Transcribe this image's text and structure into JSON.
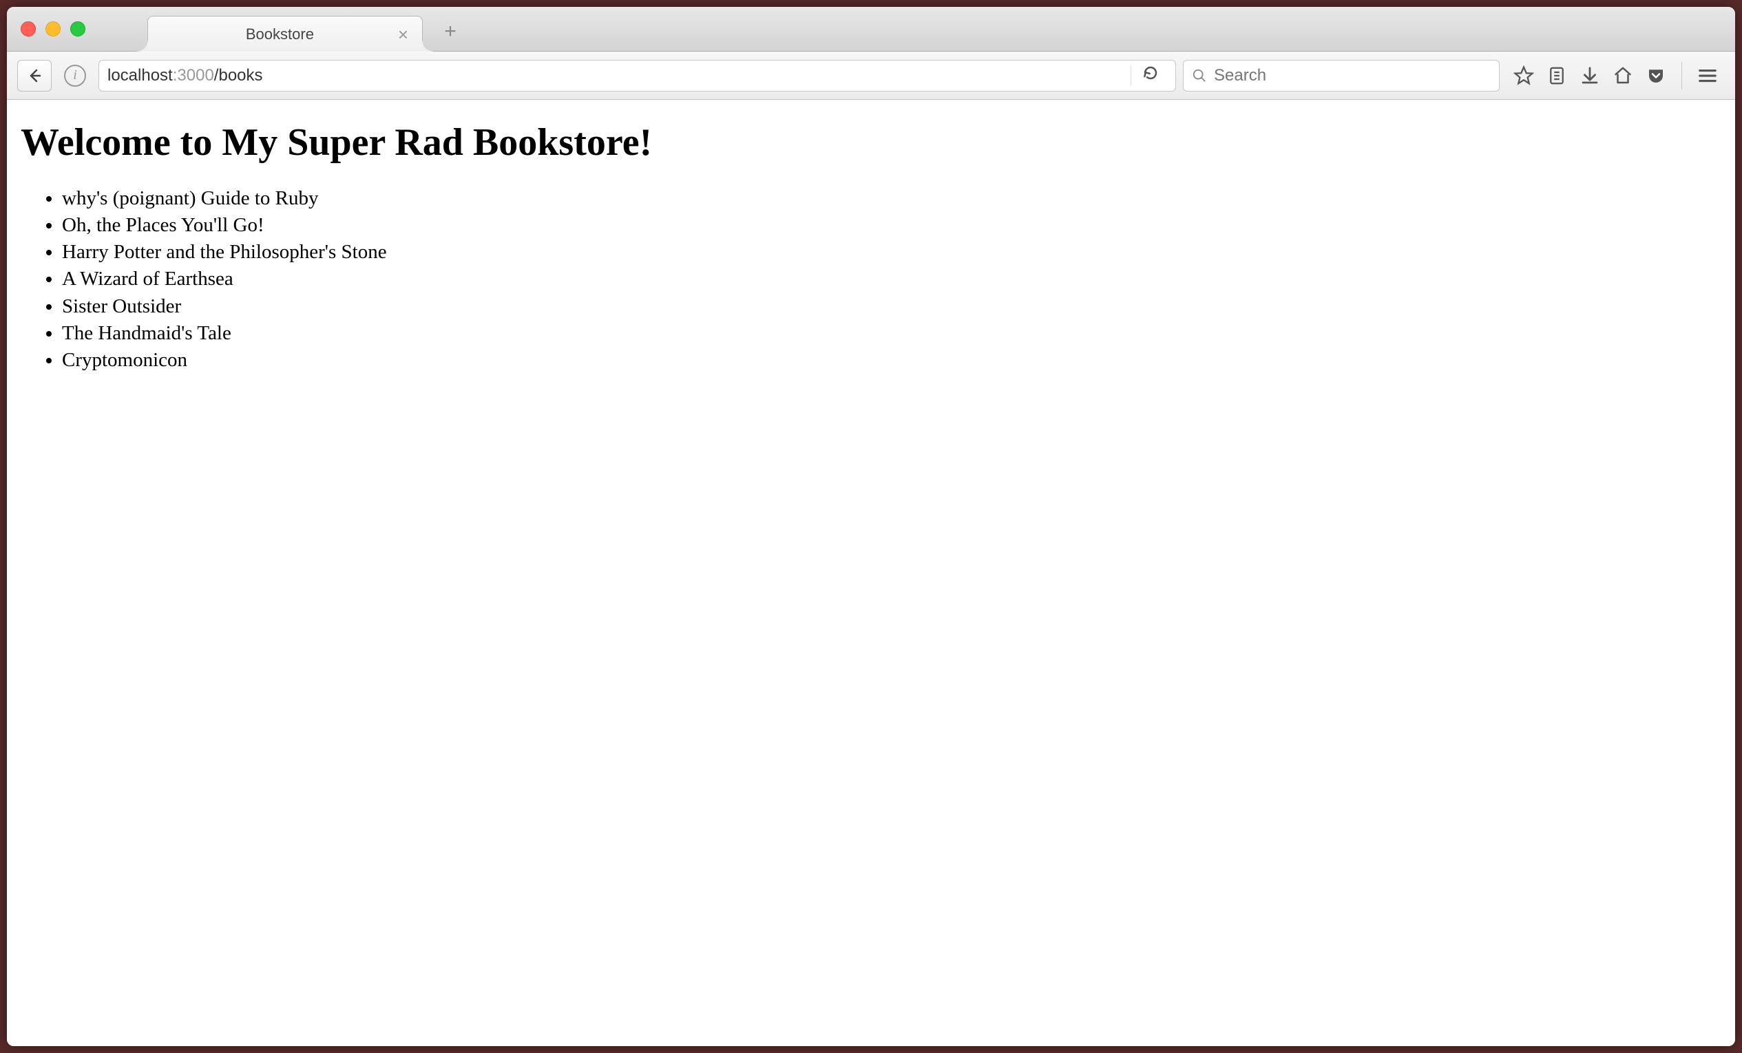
{
  "window": {
    "tab_title": "Bookstore"
  },
  "url": {
    "host": "localhost",
    "port": ":3000",
    "path": "/books"
  },
  "search": {
    "placeholder": "Search"
  },
  "page": {
    "heading": "Welcome to My Super Rad Bookstore!",
    "books": [
      "why's (poignant) Guide to Ruby",
      "Oh, the Places You'll Go!",
      "Harry Potter and the Philosopher's Stone",
      "A Wizard of Earthsea",
      "Sister Outsider",
      "The Handmaid's Tale",
      "Cryptomonicon"
    ]
  }
}
